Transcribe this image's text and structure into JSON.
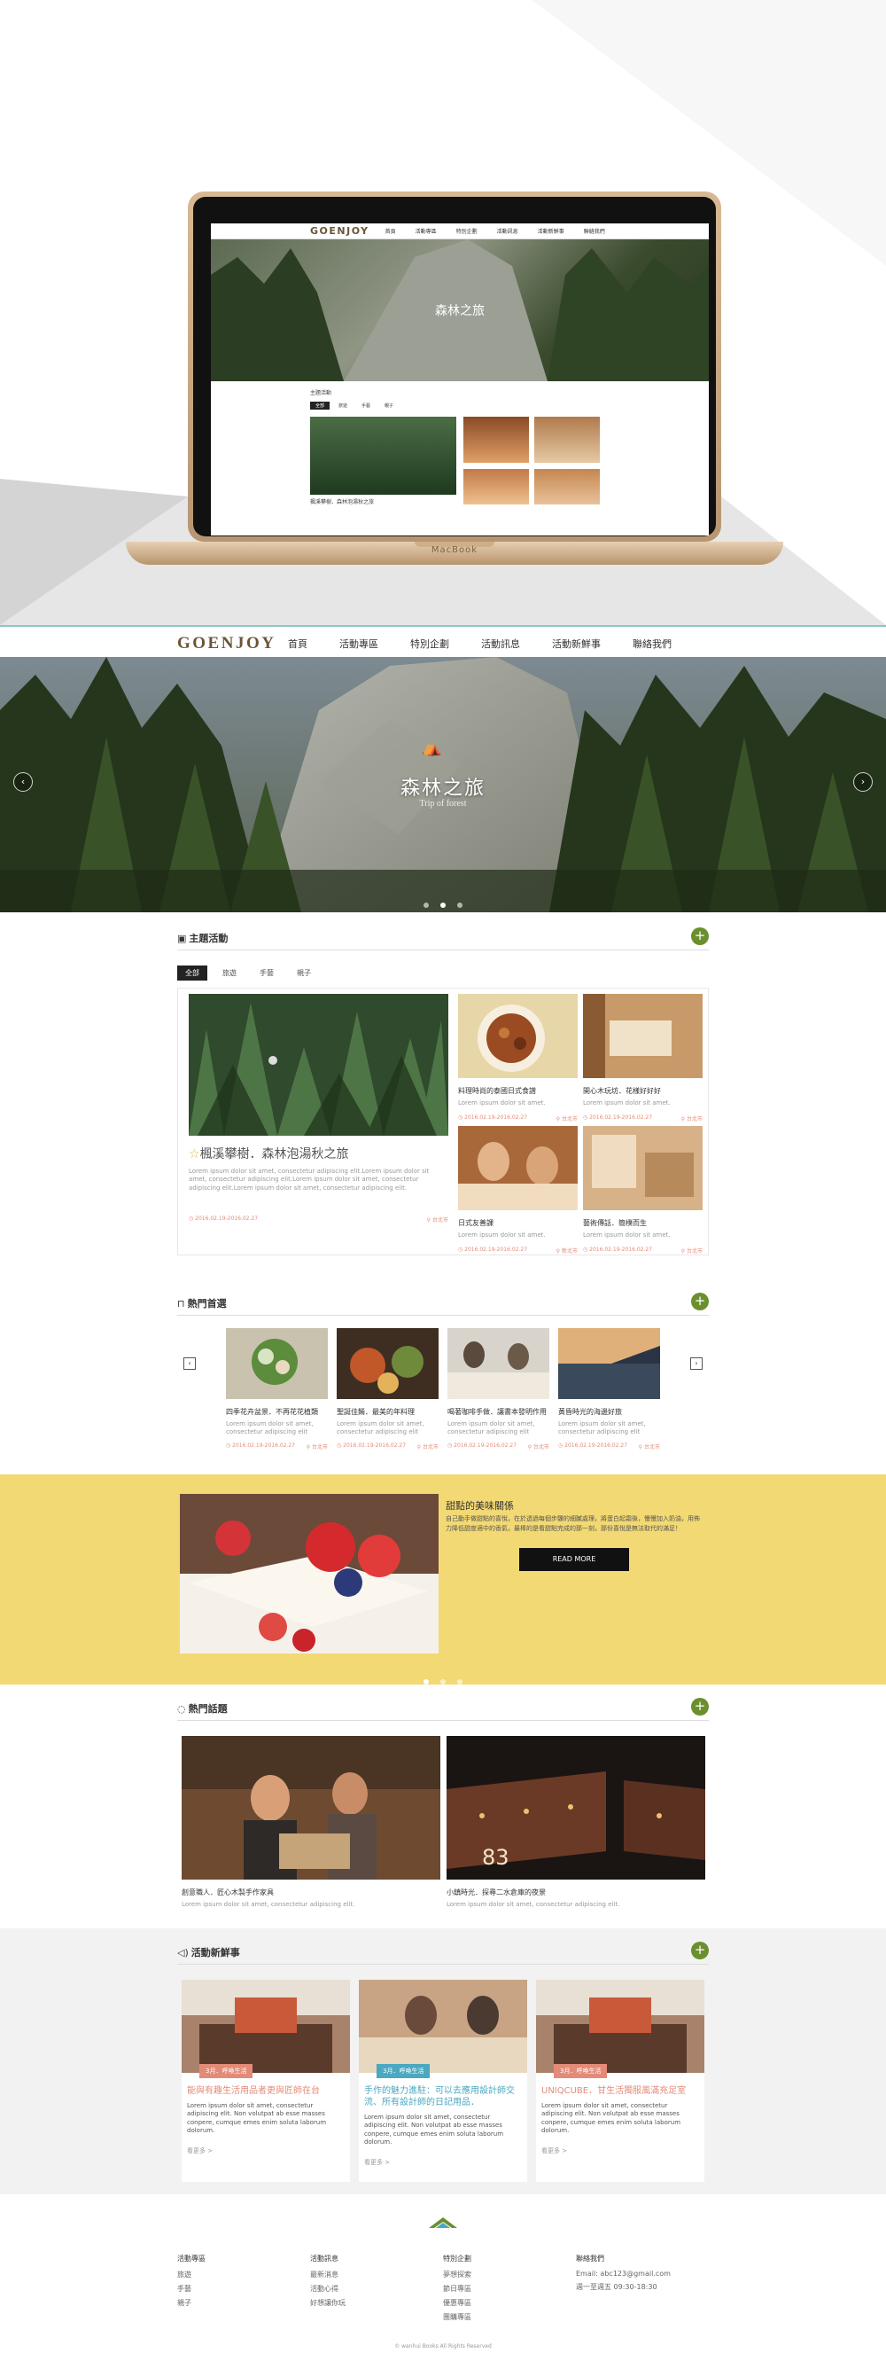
{
  "mockup": {
    "logo": "GOENJOY",
    "nav": [
      "首頁",
      "活動專區",
      "特別企劃",
      "活動訊息",
      "活動新鮮事",
      "聯絡我們"
    ],
    "banner_title": "森林之旅",
    "section_title": "主題活動",
    "tabs": [
      "全部",
      "旅遊",
      "手藝",
      "親子"
    ],
    "card_title": "楓溪攀樹．森林泡湯秋之旅",
    "device_label": "MacBook"
  },
  "header": {
    "logo": "GOENJOY",
    "nav": [
      "首頁",
      "活動專區",
      "特別企劃",
      "活動訊息",
      "活動新鮮事",
      "聯絡我們"
    ]
  },
  "banner": {
    "title": "森林之旅",
    "subtitle": "Trip of forest",
    "prev": "‹",
    "next": "›",
    "active_slide": 2
  },
  "featured": {
    "title": "主題活動",
    "tabs": [
      "全部",
      "旅遊",
      "手藝",
      "親子"
    ],
    "main": {
      "title": "楓溪攀樹．森林泡湯秋之旅",
      "desc": "Lorem ipsum dolor sit amet, consectetur adipiscing elit.Lorem ipsum dolor sit amet, consectetur adipiscing elit.Lorem ipsum dolor sit amet, consectetur adipiscing elit.Lorem ipsum dolor sit amet, consectetur adipiscing elit.",
      "date": "2016.02.19-2016.02.27",
      "location": "台北市"
    },
    "cards": [
      {
        "title": "料理時尚的泰國日式食譜",
        "desc": "Lorem ipsum dolor sit amet.",
        "date": "2016.02.19-2016.02.27",
        "location": "台北市"
      },
      {
        "title": "開心木玩坊．花樣好好好",
        "desc": "Lorem ipsum dolor sit amet.",
        "date": "2016.02.19-2016.02.27",
        "location": "台北市"
      },
      {
        "title": "日式友善課",
        "desc": "Lorem ipsum dolor sit amet.",
        "date": "2016.02.19-2016.02.27",
        "location": "新北市"
      },
      {
        "title": "藝術傳話．簡樸而生",
        "desc": "Lorem ipsum dolor sit amet.",
        "date": "2016.02.19-2016.02.27",
        "location": "台北市"
      }
    ]
  },
  "popular": {
    "title": "熱門首選",
    "prev": "‹",
    "next": "›",
    "cards": [
      {
        "title": "四季花卉盆景．不再花花植類",
        "desc": "Lorem ipsum dolor sit amet, consectetur adipiscing elit",
        "date": "2016.02.19-2016.02.27",
        "location": "台北市"
      },
      {
        "title": "聖誕佳餚．最美的年料理",
        "desc": "Lorem ipsum dolor sit amet, consectetur adipiscing elit",
        "date": "2016.02.19-2016.02.27",
        "location": "台北市"
      },
      {
        "title": "喝著咖啡手做．讓書本發明作用",
        "desc": "Lorem ipsum dolor sit amet, consectetur adipiscing elit",
        "date": "2016.02.19-2016.02.27",
        "location": "台北市"
      },
      {
        "title": "黃昏時光的海邊好旅",
        "desc": "Lorem ipsum dolor sit amet, consectetur adipiscing elit",
        "date": "2016.02.19-2016.02.27",
        "location": "台北市"
      }
    ]
  },
  "promo": {
    "title": "甜點的美味關係",
    "text": "自己動手做甜點的喜悅，在於透過每個步驟的細膩處理，將蛋白起霜後，慢慢加入奶油，用佈力降低甜度適中的香氣，最棒的是看甜點完成的那一刻，那份喜悅是無法取代的滿足！",
    "button": "READ MORE",
    "active_slide": 0
  },
  "topics": {
    "title": "熱門話題",
    "cards": [
      {
        "title": "創意職人．匠心木製手作家具",
        "desc": "Lorem ipsum dolor sit amet, consectetur adipiscing elit."
      },
      {
        "title": "小鎮時光．探尋二水倉庫的夜景",
        "desc": "Lorem ipsum dolor sit amet, consectetur adipiscing elit."
      }
    ]
  },
  "news": {
    "title": "活動新鮮事",
    "cards": [
      {
        "tag": "3月．呼喚生活",
        "title": "能與有趣生活用品者更與匠師在台",
        "text": "Lorem ipsum dolor sit amet, consectetur adipiscing elit. Non volutpat ab esse masses conpere, cumque emes enim soluta laborum dolorum.",
        "more": "看更多 >",
        "color": "#e38b78"
      },
      {
        "tag": "3月．呼喚生活",
        "title": "手作的魅力進駐：可以去應用設計師交流、所有設計師的日記用品．",
        "text": "Lorem ipsum dolor sit amet, consectetur adipiscing elit. Non volutpat ab esse masses conpere, cumque emes enim soluta laborum dolorum.",
        "more": "看更多 >",
        "color": "#4aa8c0"
      },
      {
        "tag": "3月．呼喚生活",
        "title": "UNIQCUBE．甘生活獨服風滿充足室",
        "text": "Lorem ipsum dolor sit amet, consectetur adipiscing elit. Non volutpat ab esse masses conpere, cumque emes enim soluta laborum dolorum.",
        "more": "看更多 >",
        "color": "#e38b78"
      }
    ]
  },
  "footer": {
    "columns": [
      {
        "heading": "活動專區",
        "links": [
          "旅遊",
          "手藝",
          "親子"
        ]
      },
      {
        "heading": "活動訊息",
        "links": [
          "最新消息",
          "活動心得",
          "好想讓你玩"
        ]
      },
      {
        "heading": "特別企劃",
        "links": [
          "夢想探索",
          "節日專區",
          "優惠專區",
          "團購專區"
        ]
      },
      {
        "heading": "聯絡我們",
        "links": [
          "Email: abc123@gmail.com",
          "週一至週五 09:30-18:30"
        ]
      }
    ],
    "copyright": "© wanhui Books All Rights Reserved"
  },
  "colors": {
    "brand": "#6b5535",
    "accent_green": "#6b8f2e",
    "promo_yellow": "#f3d973",
    "meta_pink": "#e38b78"
  }
}
